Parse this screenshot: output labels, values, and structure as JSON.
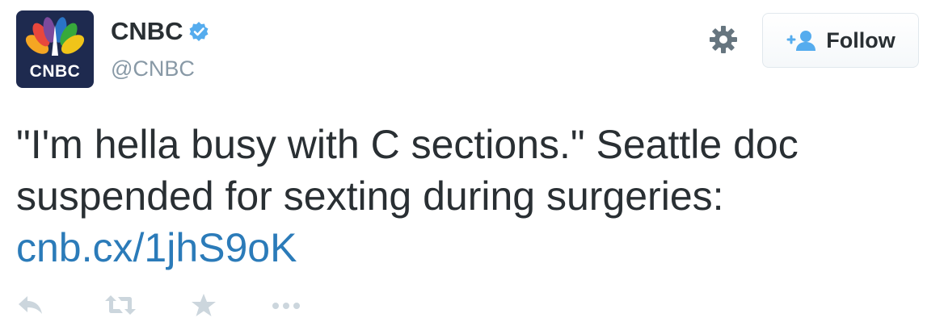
{
  "profile": {
    "avatar_text": "CNBC",
    "display_name": "CNBC",
    "handle": "@CNBC",
    "verified": true
  },
  "header": {
    "follow_label": "Follow",
    "settings_icon": "gear-icon",
    "follow_icon": "add-user-icon"
  },
  "tweet": {
    "text": "\"I'm hella busy with C sections.\" Seattle doc suspended for sexting during surgeries:",
    "link": "cnb.cx/1jhS9oK"
  },
  "actions": [
    {
      "name": "reply-icon"
    },
    {
      "name": "retweet-icon"
    },
    {
      "name": "favorite-icon"
    },
    {
      "name": "more-icon"
    }
  ],
  "colors": {
    "link": "#2b7bb9",
    "verified": "#55acee",
    "muted": "#8899a6",
    "action_icon": "#ccd6dd",
    "avatar_bg": "#1e2a4f"
  }
}
